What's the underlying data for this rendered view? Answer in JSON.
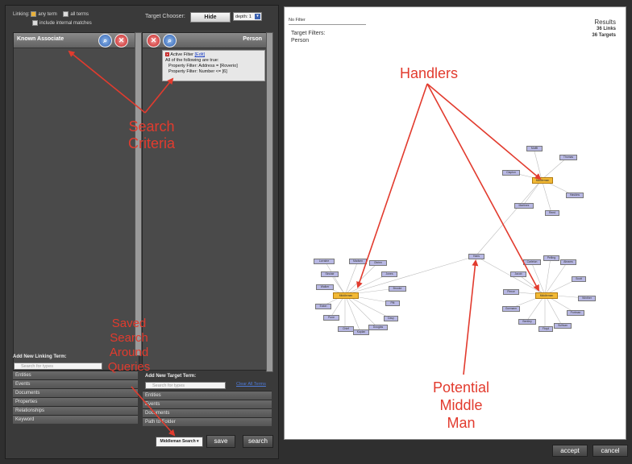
{
  "toolbar": {
    "linking_label": "Linking:",
    "any_term": "any term",
    "all_terms": "all terms",
    "include_internal": "include internal matches",
    "target_chooser_label": "Target Chooser:",
    "hide_button": "Hide",
    "depth_value": "depth: 1"
  },
  "left_panel": {
    "title": "Known Associate"
  },
  "right_panel": {
    "title": "Person",
    "active_filter_label": "Active Filter",
    "edit_link": "[Edit]",
    "filter_lines": [
      "All of the following are true:",
      "Property Filter: Address = [Roverio]",
      "Property Filter: Number <= [6]"
    ]
  },
  "linking_terms": {
    "heading": "Add New Linking Term:",
    "search_placeholder": "Search for types",
    "items": [
      "Entities",
      "Events",
      "Documents",
      "Properties",
      "Relationships",
      "Keyword"
    ]
  },
  "target_terms": {
    "heading": "Add New Target Term:",
    "search_placeholder": "Search for types",
    "clear_all": "Clear All Terms",
    "items": [
      "Entities",
      "Events",
      "Documents",
      "Path to Folder"
    ]
  },
  "bottom_bar": {
    "search_select": "Middleman Search",
    "save_button": "save",
    "search_button": "search",
    "accept_button": "accept",
    "cancel_button": "cancel"
  },
  "results": {
    "filter_value": "No Filter",
    "target_filters_label": "Target Filters:",
    "target_filters_value": "Person",
    "heading": "Results",
    "links": "36 Links",
    "targets": "36 Targets"
  },
  "graph": {
    "left_center": "Middleman",
    "left_nodes": [
      "Lorraine",
      "Madsen",
      "Obrien",
      "Jones",
      "Sinclair",
      "Brooke",
      "Walker",
      "Pitt",
      "Eaton",
      "Davy",
      "Pune",
      "Douglas",
      "Chief",
      "Kaplan"
    ],
    "top_center": "Middleman",
    "top_nodes": [
      "Moffit",
      "Thomas",
      "Clapton",
      "Haskins",
      "Martinez",
      "Reed"
    ],
    "bottom_center": "Middleman",
    "bottom_nodes": [
      "Carleton",
      "Pelling",
      "Abrams",
      "Jacob",
      "Scott",
      "Pierce",
      "Winther",
      "Gormann",
      "Portman",
      "Bentley",
      "Floyd",
      "Sullivan"
    ],
    "middle_node": "Hans"
  },
  "annotations": {
    "search_criteria": "Search\nCriteria",
    "handlers": "Handlers",
    "saved_search": "Saved\nSearch\nAround\nQueries",
    "potential_middle_man": "Potential\nMiddle\nMan"
  },
  "colors": {
    "annotation": "#e23b2e",
    "node": "#b8b8e4",
    "center_node": "#f2b935"
  }
}
